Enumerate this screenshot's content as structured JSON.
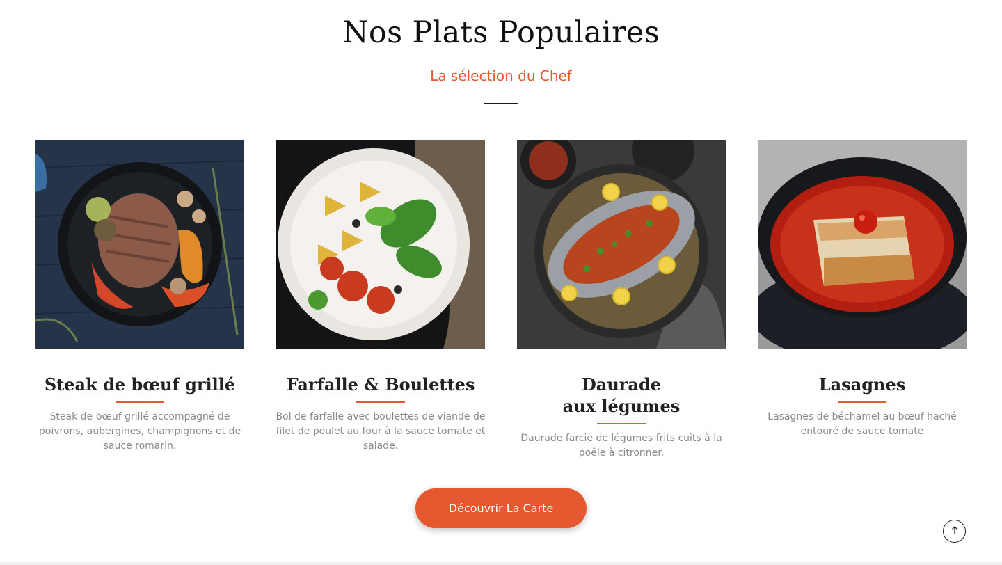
{
  "section": {
    "title": "Nos Plats Populaires",
    "subtitle": "La sélection du Chef"
  },
  "colors": {
    "accent": "#e35a34",
    "button": "#e6582f",
    "title": "#111111",
    "description": "#8a8a8a"
  },
  "dishes": [
    {
      "title": "Steak de bœuf grillé",
      "description": "Steak de bœuf grillé accompagné de poivrons, aubergines, champignons et de sauce romarin.",
      "image_icon": "steak-pan-photo"
    },
    {
      "title": "Farfalle & Boulettes",
      "description": "Bol de farfalle avec boulettes de viande de filet de poulet au four à la sauce tomate et salade.",
      "image_icon": "pasta-bowl-photo"
    },
    {
      "title_line1": "Daurade",
      "title_line2": "aux légumes",
      "description": "Daurade farcie de légumes frits cuits à la poêle à citronner.",
      "image_icon": "sea-bream-pan-photo"
    },
    {
      "title": "Lasagnes",
      "description": "Lasagnes de béchamel au bœuf haché entouré de sauce tomate",
      "image_icon": "lasagna-plate-photo"
    }
  ],
  "cta": {
    "label": "Découvrir La Carte"
  },
  "scroll_top": {
    "icon": "arrow-up-icon"
  }
}
